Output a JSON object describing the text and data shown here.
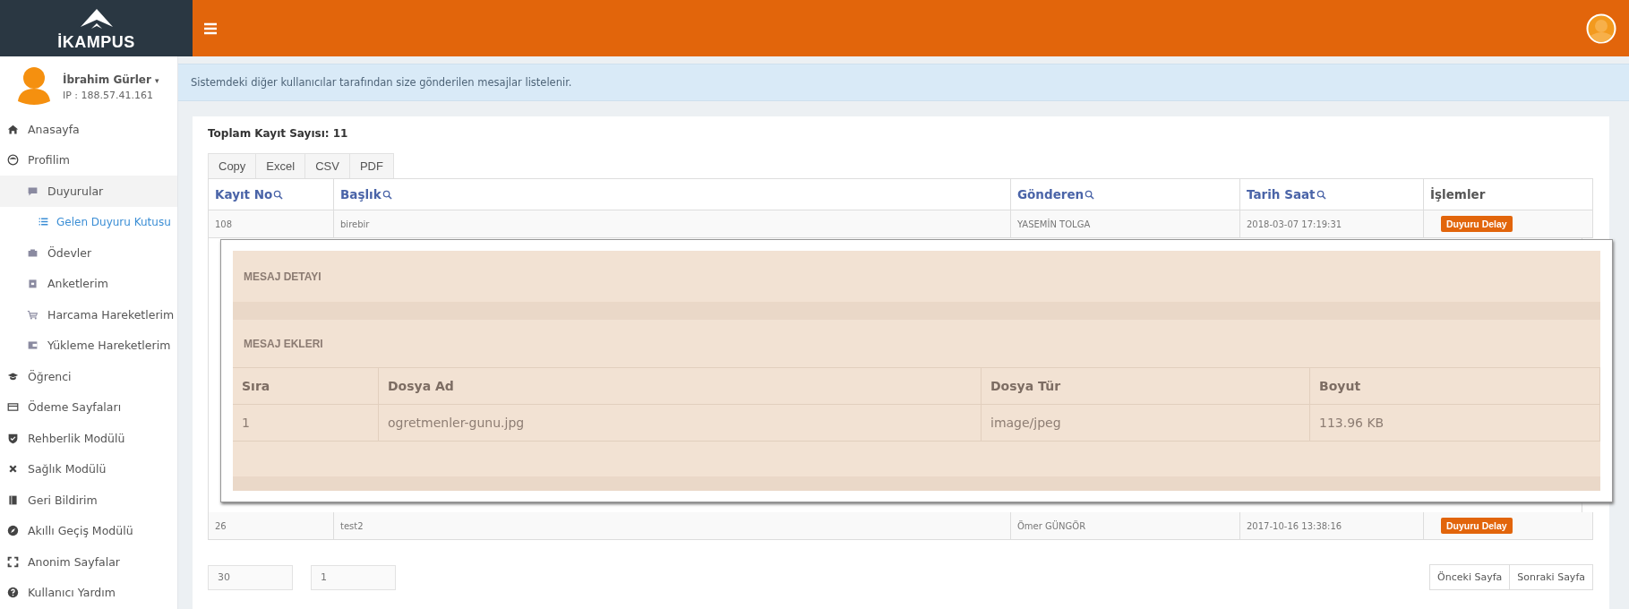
{
  "brand": {
    "name": "İKAMPUS"
  },
  "user": {
    "name": "İbrahim Gürler",
    "caret": "▾",
    "ip": "IP : 188.57.41.161"
  },
  "sidebar": {
    "items": [
      {
        "label": "Anasayfa",
        "selected": false
      },
      {
        "label": "Profilim",
        "selected": false,
        "children": [
          {
            "label": "Duyurular",
            "selected": true,
            "children": [
              {
                "label": "Gelen Duyuru Kutusu",
                "selected": true
              }
            ]
          },
          {
            "label": "Ödevler",
            "selected": false
          },
          {
            "label": "Anketlerim",
            "selected": false
          },
          {
            "label": "Harcama Hareketlerim",
            "selected": false
          },
          {
            "label": "Yükleme Hareketlerim",
            "selected": false
          }
        ]
      },
      {
        "label": "Öğrenci",
        "selected": false
      },
      {
        "label": "Ödeme Sayfaları",
        "selected": false
      },
      {
        "label": "Rehberlik Modülü",
        "selected": false
      },
      {
        "label": "Sağlık Modülü",
        "selected": false
      },
      {
        "label": "Geri Bildirim",
        "selected": false
      },
      {
        "label": "Akıllı Geçiş Modülü",
        "selected": false
      },
      {
        "label": "Anonim Sayfalar",
        "selected": false
      },
      {
        "label": "Kullanıcı Yardım",
        "selected": false
      }
    ]
  },
  "info": "Sistemdeki diğer kullanıcılar tarafından size gönderilen mesajlar listelenir.",
  "total": "Toplam Kayıt Sayısı: 11",
  "export_buttons": [
    "Copy",
    "Excel",
    "CSV",
    "PDF"
  ],
  "table": {
    "columns": [
      {
        "label": "Kayıt No",
        "searchable": true
      },
      {
        "label": "Başlık",
        "searchable": true
      },
      {
        "label": "Gönderen",
        "searchable": true
      },
      {
        "label": "Tarih Saat",
        "searchable": true
      },
      {
        "label": "İşlemler",
        "searchable": false
      }
    ],
    "rows_above": [
      {
        "cells": [
          "108",
          "birebir",
          "YASEMİN TOLGA",
          "2018-03-07 17:19:31"
        ],
        "action": "Duyuru Delay"
      }
    ],
    "rows_below": [
      {
        "cells": [
          "26",
          "test2",
          "Ömer GÜNGÖR",
          "2017-10-16 13:38:16"
        ],
        "action": "Duyuru Delay"
      }
    ]
  },
  "modal": {
    "detail_title": "MESAJ DETAYI",
    "attachments_title": "MESAJ EKLERI",
    "columns": [
      "Sıra",
      "Dosya Ad",
      "Dosya Tür",
      "Boyut"
    ],
    "rows": [
      [
        "1",
        "ogretmenler-gunu.jpg",
        "image/jpeg",
        "113.96 KB"
      ]
    ]
  },
  "pagination": {
    "page_size": "30",
    "page": "1",
    "prev": "Önceki Sayfa",
    "next": "Sonraki Sayfa"
  }
}
